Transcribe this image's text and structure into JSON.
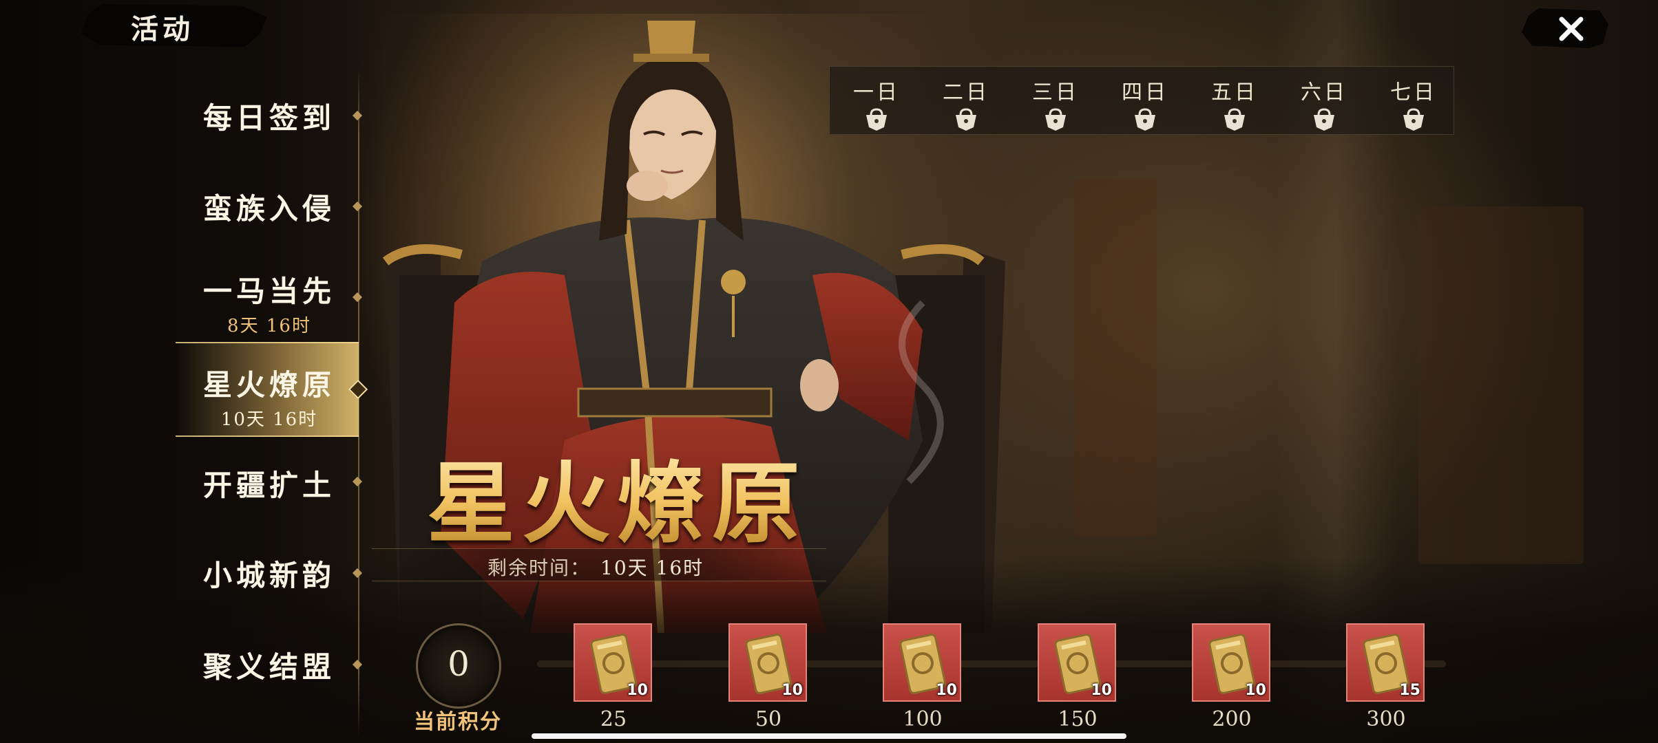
{
  "header": {
    "title": "活动",
    "close_icon": "close-icon"
  },
  "nav": {
    "items": [
      {
        "label": "每日签到",
        "timer": ""
      },
      {
        "label": "蛮族入侵",
        "timer": ""
      },
      {
        "label": "一马当先",
        "timer": "8天 16时"
      },
      {
        "label": "星火燎原",
        "timer": "10天 16时",
        "active": true
      },
      {
        "label": "开疆扩土",
        "timer": ""
      },
      {
        "label": "小城新韵",
        "timer": ""
      },
      {
        "label": "聚义结盟",
        "timer": ""
      }
    ]
  },
  "days": [
    "一日",
    "二日",
    "三日",
    "四日",
    "五日",
    "六日",
    "七日"
  ],
  "event": {
    "title": "星火燎原",
    "remain_label": "剩余时间：",
    "remain_value": "10天 16时"
  },
  "score": {
    "value": "0",
    "label": "当前积分"
  },
  "rewards": [
    {
      "count": "10",
      "threshold": "25"
    },
    {
      "count": "10",
      "threshold": "50"
    },
    {
      "count": "10",
      "threshold": "100"
    },
    {
      "count": "10",
      "threshold": "150"
    },
    {
      "count": "10",
      "threshold": "200"
    },
    {
      "count": "15",
      "threshold": "300"
    }
  ],
  "colors": {
    "accent_gold": "#f0c27a",
    "reward_red": "#b83a33",
    "title_gold": "#f6d37e"
  }
}
